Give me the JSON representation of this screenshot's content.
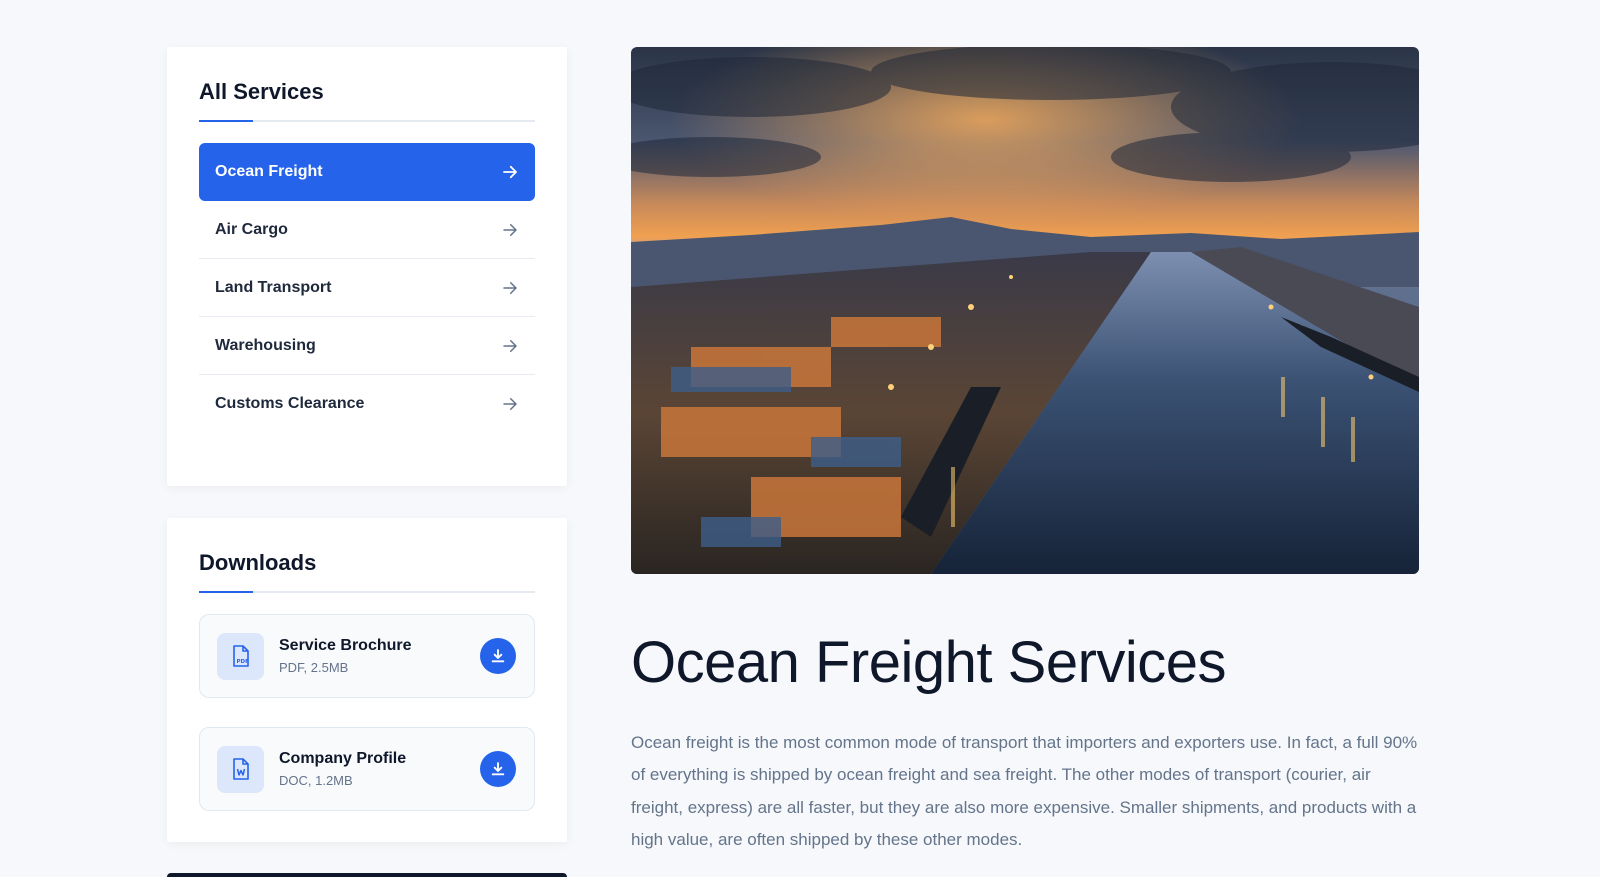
{
  "sidebar": {
    "services": {
      "title": "All Services",
      "items": [
        {
          "label": "Ocean Freight",
          "active": true
        },
        {
          "label": "Air Cargo",
          "active": false
        },
        {
          "label": "Land Transport",
          "active": false
        },
        {
          "label": "Warehousing",
          "active": false
        },
        {
          "label": "Customs Clearance",
          "active": false
        }
      ]
    },
    "downloads": {
      "title": "Downloads",
      "items": [
        {
          "name": "Service Brochure",
          "meta": "PDF, 2.5MB",
          "icon": "pdf-file-icon"
        },
        {
          "name": "Company Profile",
          "meta": "DOC, 1.2MB",
          "icon": "doc-file-icon"
        }
      ]
    }
  },
  "main": {
    "hero_image": "port-harbor-sunset-photo",
    "title": "Ocean Freight Services",
    "intro": "Ocean freight is the most common mode of transport that importers and exporters use. In fact, a full 90% of everything is shipped by ocean freight and sea freight. The other modes of transport (courier, air freight, express) are all faster, but they are also more expensive. Smaller shipments, and products with a high value, are often shipped by these other modes."
  },
  "colors": {
    "accent": "#2563eb",
    "background": "#f6f8fb",
    "heading": "#0f172a",
    "body_text": "#64748b"
  }
}
